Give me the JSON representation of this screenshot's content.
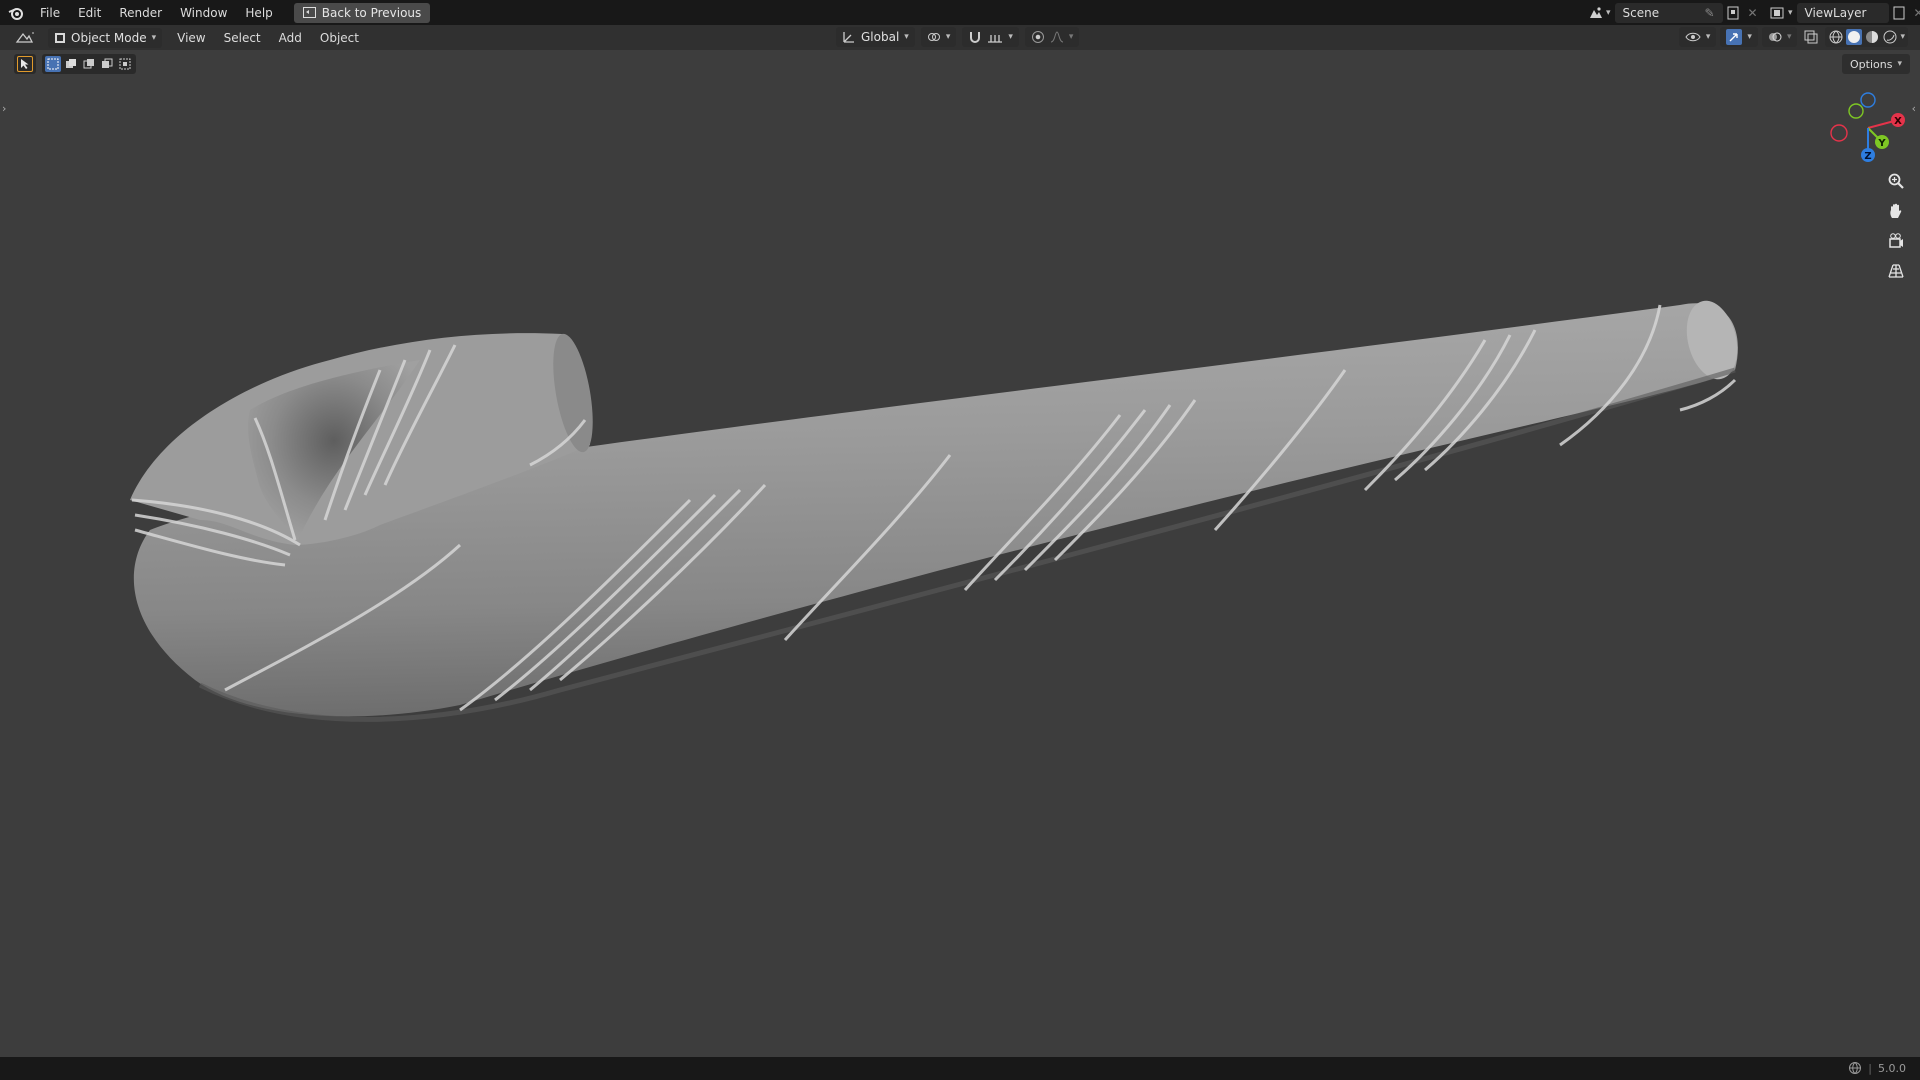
{
  "topbar": {
    "menus": [
      "File",
      "Edit",
      "Render",
      "Window",
      "Help"
    ],
    "back_label": "Back to Previous",
    "scene_name": "Scene",
    "view_layer": "ViewLayer"
  },
  "viewport_header": {
    "mode": "Object Mode",
    "menus": [
      "View",
      "Select",
      "Add",
      "Object"
    ],
    "orientation": "Global",
    "options_label": "Options"
  },
  "gizmo": {
    "x_label": "X",
    "y_label": "Y",
    "z_label": "Z",
    "x_color": "#e5334a",
    "y_color": "#7ec824",
    "z_color": "#2e7ee0"
  },
  "status": {
    "version": "5.0.0"
  },
  "colors": {
    "topbar_bg": "#181818",
    "header_bg": "#303030",
    "viewport_bg": "#3d3d3d",
    "accent": "#4772b3"
  }
}
